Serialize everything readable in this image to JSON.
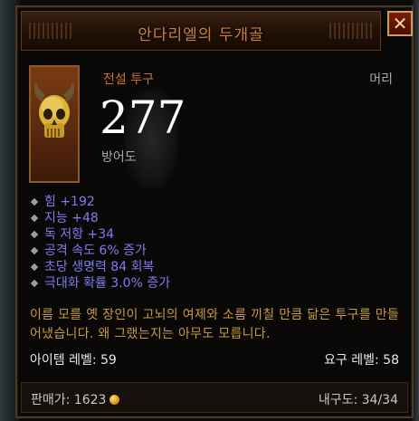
{
  "tooltip": {
    "title": "안다리엘의 두개골",
    "close_symbol": "✕",
    "item_type": "전설 투구",
    "item_slot": "머리",
    "armor_value": "277",
    "armor_label": "방어도"
  },
  "stats": [
    "힘 +192",
    "지능 +48",
    "독 저항 +34",
    "공격 속도 6% 증가",
    "초당 생명력 84 회복",
    "극대화 확률 3.0% 증가"
  ],
  "flavor_text": "이름 모를 옛 장인이 고뇌의 여제와 소름 끼칠 만큼 닮은 투구를 만들어냈습니다. 왜 그랬는지는 아무도 모릅니다.",
  "levels": {
    "item_level": "아이템 레벨: 59",
    "required_level": "요구 레벨: 58"
  },
  "footer": {
    "sell_price": "판매가: 1623",
    "durability": "내구도: 34/34"
  },
  "icons": {
    "item": "golden-skull-helm-icon",
    "currency": "gold-coin-icon",
    "stat_bullet": "diamond-bullet-icon"
  },
  "colors": {
    "title": "#cc7e3a",
    "legendary_type": "#c8722e",
    "stat": "#7c7cf2",
    "flavor": "#c89a42"
  }
}
